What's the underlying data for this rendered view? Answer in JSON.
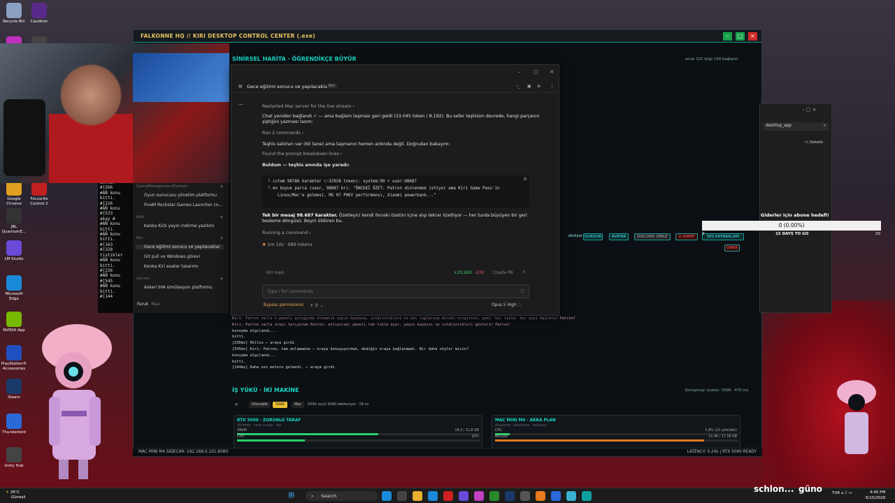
{
  "desktop_icons": [
    {
      "label": "Recycle Bin",
      "color": "#8aa0c0"
    },
    {
      "label": "Cauldron",
      "color": "#5a2a8a"
    },
    {
      "label": "",
      "color": "#c030c0"
    },
    {
      "label": "",
      "color": "#444"
    },
    {
      "label": "Google Chrome",
      "color": "#e0a020"
    },
    {
      "label": "Focusrite Control 2",
      "color": "#c02020"
    },
    {
      "label": "JBL QuantumE...",
      "color": "#333"
    },
    {
      "label": "LM Studio",
      "color": "#6a4ad8"
    },
    {
      "label": "Microsoft Edge",
      "color": "#1a8ad8"
    },
    {
      "label": "NVIDIA App",
      "color": "#76b900"
    },
    {
      "label": "PlayStation® Accessories",
      "color": "#2050c0"
    },
    {
      "label": "Steam",
      "color": "#1a3a6a"
    },
    {
      "label": "Thunderbird",
      "color": "#2a6ad8"
    },
    {
      "label": "Unity Hub",
      "color": "#444"
    }
  ],
  "app": {
    "title": "FALKONNE HQ // KIRI DESKTOP CONTROL CENTER (.exe)",
    "map_header": "SİNİRSEL HARİTA · ÖĞRENDİKÇE BÜYÜR",
    "map_stats": "anıdı   101 bilgi   190 bağlantı",
    "workload_title": "İŞ YÜKÜ · İKİ MAKİNE",
    "workload_right": "Konuşmayı ücaları:  5090  ·  470 ms",
    "status_left": "MAC MINI M4 SIDECAR: 192.168.0.101:8080",
    "status_right": "LATENCY: 0.24s | RTX 5090 READY",
    "control_buttons": [
      "dinliyor",
      "DURDUR",
      "AVATAR",
      "DISCORD DİNLE",
      "⊙ KAPAT",
      "SES KAYNAKLARI",
      "ONAR"
    ]
  },
  "chat": {
    "tab_title": "Gece eğitimi sonucu ve yapılacaklar",
    "tab_badge": "Kiri",
    "lines": [
      {
        "text": "Restarted Mac server for the live stream  ›",
        "muted": true
      },
      {
        "text": "Chat yeniden bağlandı ✓ — ama bağlam taşması geri geldi (33.045 token / 8.192). Bu sefer teşhisim devrede, hangi parçanın şiştiğini yazması lazım:",
        "muted": false
      },
      {
        "text": "Ran 2 commands  ›",
        "muted": true
      },
      {
        "text": "Teşhis satırları var (60 tane) ama taşmanın hemen ardında değil. Doğrudan bakayım:",
        "muted": false
      },
      {
        "text": "Found the prompt breakdown lines  ›",
        "muted": true
      },
      {
        "text": "Buldum — teşhis anında işe yaradı:",
        "muted": false
      }
    ],
    "code": "└ istem 98786 karakter (~32928 token): system:99 + user:98687\n└ en buyuk parca (user, 98687 kr): \"ÖNCEKİ ÖZET: Patron dinlenmek istiyor ama Kiri Game Pass'in\n    Linux/Mac'e gelmesi, MG 07 PHEV performansı, Xiaomi powerbank...\"",
    "after_code": "Tek bir mesaj 98.687 karakter. Özetleyici kendi önceki özetini içine alıp tekrar özetliyor — her turda büyüyen bir geri besleme döngüsü. Beyni öldüren bu.",
    "running": "Running a command  ›",
    "timer": "1m 10s · 989 tokens",
    "diff_label": "Kiri  main",
    "diff_add": "+20,269",
    "diff_del": "-239",
    "create_pr": "Create PR",
    "input_placeholder": "Type / for commands",
    "bypass": "Bypass permissions",
    "model": "Opus 5",
    "effort": "High"
  },
  "sessions": {
    "groups": [
      {
        "name": "GameManagementSystem",
        "items": [
          "Oyun sunucusu yönetim platformu",
          "FiveM Rockstar Games Launcher co..."
        ]
      },
      {
        "name": "Kick",
        "items": [
          "Kanka Kick yayın indirme yazılımı"
        ]
      },
      {
        "name": "Kiri",
        "items": [
          "Gece eğitimi sonucu ve yapılacaklar",
          "Git pull ve Windows görevi",
          "Kanka Kiri avatar tasarımı"
        ]
      },
      {
        "name": "sol-sim",
        "items": [
          "Askeri İHA simülasyon platformu"
        ]
      }
    ],
    "user": "Faruk",
    "user_sub": "Max"
  },
  "terminal_left": "bitti.\n#[266\n#ÂÑ konu\nbitti.\n#[226\n#ÂÑ konu\n#[523\nakay #\n#ÂÑ konu\nbitti.\n#ÂÑ konu\nbitti.\n#[163\n#[328\ntistikler\n#ÂÑ konu\nbitti.\n#[236\n#ÂÑ konu\n#[545\n#ÂÑ konu\nbitti.\n#[144",
  "log_lines": [
    "Kiri: Patron valla o paneli açtığında otomatik yayın kaydına, istatistiklere ve bot loglarına direkt erişirsin; yani 'bir tıkla' her şeyi başlatır Patron!",
    "Kiri: Patron valla orayı tarıyorum Patron, anlıyorum; paneli tek tıkla açar, yayın kaydını ve istatistikleri gösterir Patron!",
    "konuşma algılandı...",
    "bitti.",
    "[236ms] Helloo  ← araya girdi",
    "[545ms] Kiri: Patron, tam anlamadım — oraya konuşuyordum, dediğin oraya bağlanmadı. Bir daha söyler misin?",
    "konuşma algılandı...",
    "bitti.",
    "[144ms] Daha ses motoru gelmedi.  ← araya girdi"
  ],
  "workload": {
    "tabs": [
      "Otomatik",
      "5090",
      "Mac"
    ],
    "tabs_note": "5090 seçili  5090 bekleniyor · 59 sn",
    "cards": [
      {
        "title": "RTX 5090 · ZORUNLU TARAF",
        "sub": "dinleme · canlı cevap · ses",
        "bars": [
          {
            "label": "VRAM",
            "value": "18,3 / 31,8 GB",
            "pct": 0.58,
            "color": "#2ad06a"
          },
          {
            "label": "CPU",
            "value": "20%",
            "pct": 0.28,
            "color": "#2ad06a"
          }
        ]
      },
      {
        "title": "MAC MINI M4 · ARKA PLAN",
        "sub": "düşünme · planlama · hafızaya",
        "bars": [
          {
            "label": "CPU",
            "value": "5.8% (10 çekirdek)",
            "pct": 0.06,
            "color": "#2ad06a"
          },
          {
            "label": "BELLEK",
            "value": "11.46 / 17.18 GB",
            "pct": 0.86,
            "color": "#e07a20"
          }
        ]
      }
    ]
  },
  "explorer": {
    "address": "desktop_app",
    "details": "Details"
  },
  "sub_goal": {
    "title": "Giderler için abone hedefi!",
    "progress": "0 (0.00%)",
    "progress_pct": 0,
    "days": "15 DAYS TO GO",
    "start": "0",
    "max": "20"
  },
  "taskbar": {
    "weather_temp": "26°C",
    "weather_desc": "Güneşli",
    "search": "Search",
    "lang": "TUR",
    "time": "4:40 PM",
    "date": "6/15/2026",
    "brand_a": "schlon...",
    "brand_b": "güno"
  }
}
